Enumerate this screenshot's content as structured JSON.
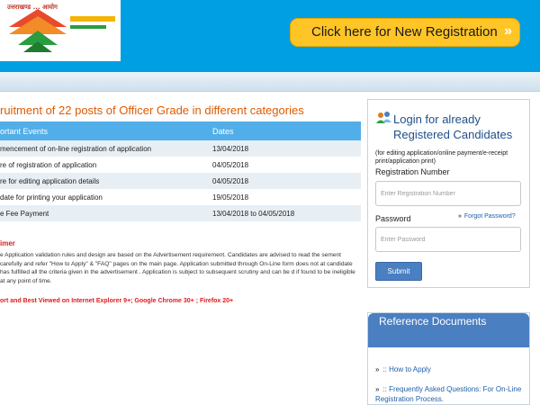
{
  "header": {
    "logo_text": "उत्तराखण्ड ... आयोग",
    "register_button": "Click here for New Registration",
    "register_chevron": "»"
  },
  "main": {
    "title": "ruitment of 22 posts of Officer Grade in different categories",
    "table": {
      "columns": [
        "ortant Events",
        "Dates"
      ],
      "rows": [
        [
          "mencement of on-line registration of application",
          "13/04/2018"
        ],
        [
          "re of registration of application",
          "04/05/2018"
        ],
        [
          "re for editing application details",
          "04/05/2018"
        ],
        [
          "date for printing your application",
          "19/05/2018"
        ],
        [
          "e Fee Payment",
          "13/04/2018 to 04/05/2018"
        ]
      ]
    },
    "disclaimer_heading": "imer",
    "disclaimer_body": "e Application validation rules and design are based on the Advertisement requirement. Candidates are advised to read the sement carefully and refer \"How to Apply\" & \"FAQ\" pages on the main page. Application submitted through On-Line form does not at candidate has fulfilled all the criteria given in the advertisement . Application is subject to subsequent scrutiny and can be d if found to be ineligible at any point of time.",
    "browser_note": "ort and Best Viewed on Internet Explorer 9+; Google Chrome 30+ ; Firefox 20+"
  },
  "login": {
    "icon": "users-icon",
    "title": "Login for already Registered Candidates",
    "note": "(for editing application/online payment/e-receipt print/application print)",
    "reg_label": "Registration Number",
    "reg_placeholder": "Enter Registration Number",
    "password_label": "Password",
    "forgot_chevron": "»",
    "forgot_link": "Forgot Password?",
    "password_placeholder": "Enter Password",
    "submit": "Submit"
  },
  "reference": {
    "heading": "Reference Documents",
    "items": [
      {
        "chevron": "»",
        "label": ":: How to Apply"
      },
      {
        "chevron": "»",
        "label": ":: Frequently Asked Questions: For On-Line Registration Process."
      }
    ]
  },
  "colors": {
    "header_blue": "#009ee3",
    "button_yellow": "#ffc526",
    "title_orange": "#e05a00",
    "table_header": "#52aee8",
    "alert_red": "#e21b1b",
    "panel_blue": "#4a7fc1"
  }
}
